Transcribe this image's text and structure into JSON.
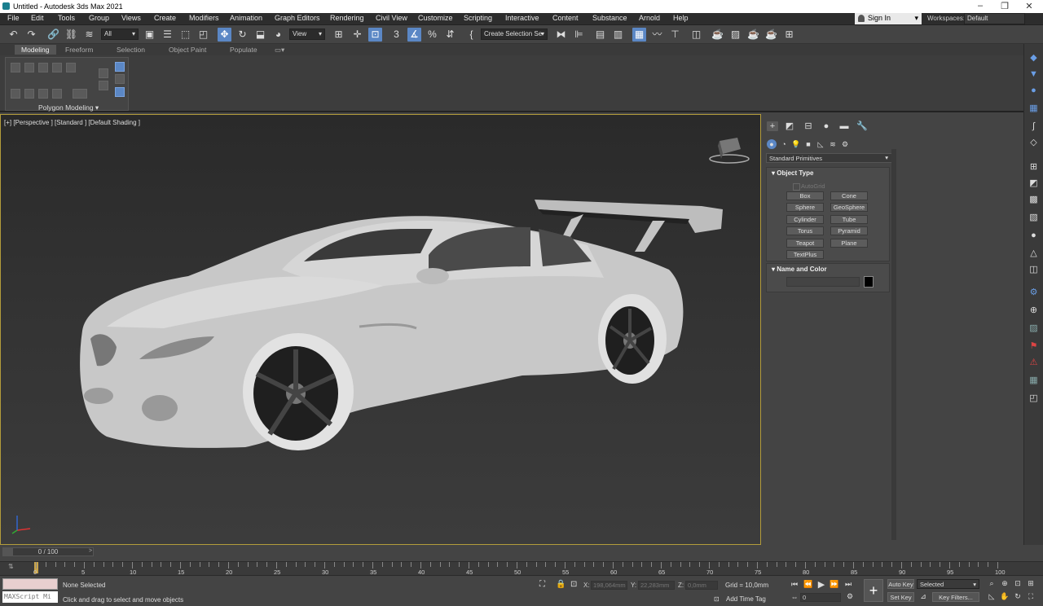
{
  "window": {
    "title": "Untitled - Autodesk 3ds Max 2021",
    "minimize": "–",
    "restore": "❐",
    "close": "✕"
  },
  "menu": {
    "items": [
      "File",
      "Edit",
      "Tools",
      "Group",
      "Views",
      "Create",
      "Modifiers",
      "Animation",
      "Graph Editors",
      "Rendering",
      "Civil View",
      "Customize",
      "Scripting",
      "Interactive",
      "Content",
      "Substance",
      "Arnold",
      "Help"
    ],
    "sign_in": "Sign In",
    "workspaces_label": "Workspaces:",
    "workspaces_value": "Default"
  },
  "toolbar": {
    "filter": "All",
    "ref_coord": "View",
    "selection_set": "Create Selection Se",
    "snap_label": "3",
    "angle_label": "%"
  },
  "ribbon": {
    "tabs": [
      "Modeling",
      "Freeform",
      "Selection",
      "Object Paint",
      "Populate"
    ],
    "active_tab": "Modeling",
    "panel_label": "Polygon Modeling ▾"
  },
  "viewport": {
    "label": "[+] [Perspective ] [Standard ] [Default Shading ]"
  },
  "command_panel": {
    "dropdown": "Standard Primitives",
    "object_type": {
      "title": "Object Type",
      "autogrid": "AutoGrid",
      "buttons": [
        "Box",
        "Cone",
        "Sphere",
        "GeoSphere",
        "Cylinder",
        "Tube",
        "Torus",
        "Pyramid",
        "Teapot",
        "Plane",
        "TextPlus"
      ]
    },
    "name_color": {
      "title": "Name and Color",
      "color": "#000000"
    }
  },
  "timeline": {
    "slider": "0 / 100",
    "ticks": [
      "0",
      "5",
      "10",
      "15",
      "20",
      "25",
      "30",
      "35",
      "40",
      "45",
      "50",
      "55",
      "60",
      "65",
      "70",
      "75",
      "80",
      "85",
      "90",
      "95",
      "100"
    ]
  },
  "status": {
    "maxscript": "MAXScript Mi",
    "selection": "None Selected",
    "prompt": "Click and drag to select and move objects",
    "x_label": "X:",
    "x_value": "198,064mm",
    "y_label": "Y:",
    "y_value": "22,283mm",
    "z_label": "Z:",
    "z_value": "0,0mm",
    "grid": "Grid = 10,0mm",
    "add_time_tag": "Add Time Tag",
    "auto_key": "Auto Key",
    "set_key": "Set Key",
    "selected": "Selected",
    "key_filters": "Key Filters...",
    "frame": "0"
  },
  "colors": {
    "viewport_border": "#b39c3b",
    "active_button": "#5b87c5"
  }
}
